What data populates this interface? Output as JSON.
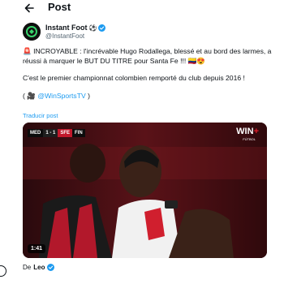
{
  "header": {
    "title": "Post"
  },
  "author": {
    "name": "Instant Foot",
    "emoji": "⚽",
    "handle": "@InstantFoot"
  },
  "tweet": {
    "line1": "🚨 INCROYABLE : l'incrévable Hugo Rodallega, blessé et au bord des larmes, a réussi à marquer le BUT DU TITRE pour Santa Fe !!! 🇨🇴😍",
    "line2": "C'est le premier championnat colombien remporté du club depuis 2016 !",
    "credit_prefix": "( 🎥 ",
    "credit_mention": "@WinSportsTV",
    "credit_suffix": " )",
    "translate": "Traducir post"
  },
  "video": {
    "team1": "MED",
    "score": "1 - 1",
    "team2": "SFE",
    "clock": "FIN",
    "brand": "WIN",
    "brand_plus": "+",
    "brand_sub": "FÚTBOL",
    "duration": "1:41"
  },
  "reply": {
    "prefix": "De",
    "name": "Leo"
  },
  "colors": {
    "accent": "#1d9bf0",
    "text": "#0f1419",
    "muted": "#536471"
  }
}
